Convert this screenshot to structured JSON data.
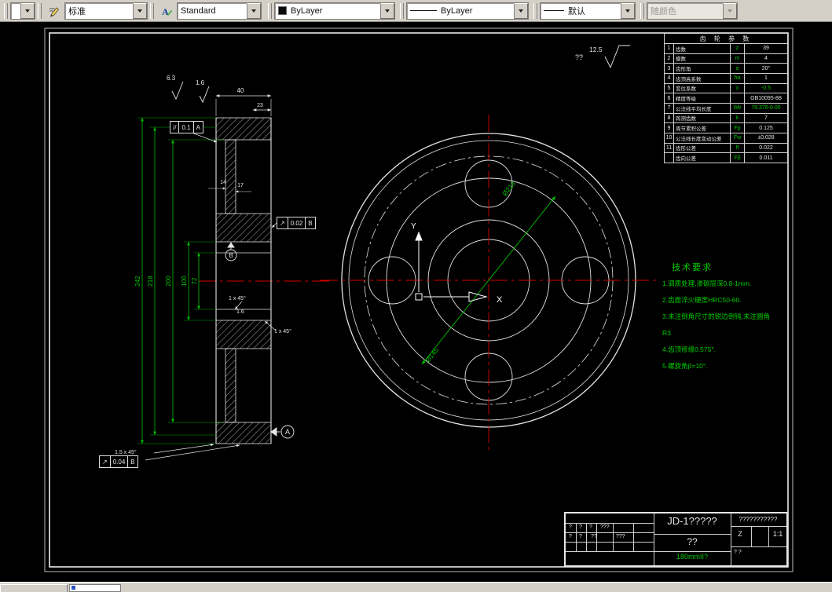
{
  "toolbar": {
    "combo_empty": "",
    "style": "标准",
    "text_style": "Standard",
    "color": "ByLayer",
    "linetype": "ByLayer",
    "lineweight": "默认",
    "plot_style": "随颜色"
  },
  "drawing": {
    "roughness_note": {
      "prefix": "??",
      "value": "12.5"
    },
    "section": {
      "finish_a": "6.3",
      "finish_b": "1.6",
      "dim_242": "242",
      "dim_218": "218",
      "dim_200": "200",
      "dim_100": "100",
      "dim_72": "72",
      "dim_40": "40",
      "dim_23": "23",
      "dim_14": "14",
      "dim_17": "17",
      "chamfer_bore_top": "1 x 45°",
      "chamfer_r": "1.6",
      "chamfer_bore_bottom": "1 x 45°",
      "chamfer_rim": "1.5 x 45°",
      "tol_parallel": {
        "sym": "//",
        "val": "0.1",
        "datum": "A"
      },
      "tol_runout_1": {
        "sym": "↗",
        "val": "0.02",
        "datum": "B"
      },
      "tol_runout_2": {
        "sym": "↗",
        "val": "0.04",
        "datum": "B"
      },
      "datum_a": "A",
      "datum_b": "B"
    },
    "front": {
      "dia_outer": "Ø216",
      "dia_inner": "Ø145",
      "ucs_x": "X",
      "ucs_y": "Y"
    }
  },
  "param_table": {
    "title": "齿 轮 参 数",
    "rows": [
      {
        "no": "1",
        "name": "齿数",
        "sym": "z",
        "val": "39"
      },
      {
        "no": "2",
        "name": "模数",
        "sym": "m",
        "val": "4"
      },
      {
        "no": "3",
        "name": "齿形角",
        "sym": "α",
        "val": "20°"
      },
      {
        "no": "4",
        "name": "齿顶高系数",
        "sym": "ha",
        "val": "1"
      },
      {
        "no": "5",
        "name": "变位系数",
        "sym": "x",
        "val": "-0.5"
      },
      {
        "no": "6",
        "name": "精度等级",
        "sym": "",
        "val": "GB10095-88"
      },
      {
        "no": "7",
        "name": "公法线平均长度",
        "sym": "Wk",
        "val": "79.376-0.05"
      },
      {
        "no": "8",
        "name": "跨测齿数",
        "sym": "k",
        "val": "7"
      },
      {
        "no": "9",
        "name": "周节累积公差",
        "sym": "Fp",
        "val": "0.125"
      },
      {
        "no": "10",
        "name": "公法线长度变动公差",
        "sym": "Fw",
        "val": "±0.028"
      },
      {
        "no": "11",
        "name": "齿形公差",
        "sym": "ff",
        "val": "0.022"
      },
      {
        "no": "",
        "name": "齿向公差",
        "sym": "Fβ",
        "val": "0.011"
      }
    ]
  },
  "notes": {
    "title": "技术要求",
    "items": [
      "1.调质处理,渗碳层深0.8-1mm.",
      "2.齿面淬火硬度HRC50-60.",
      "3.未注倒角尺寸的锐边倒钝,未注圆角",
      "R3.",
      "4.齿顶修缘0.575°.",
      "5.螺旋角β=10°."
    ]
  },
  "title_block": {
    "part_no": "JD-1?????",
    "company": "???????????",
    "part_name": "??",
    "material": "180mmII?",
    "scale": "1:1",
    "z_mark": "Z",
    "marks": [
      "?",
      "?",
      "?",
      "???",
      "?",
      "?",
      "??",
      "? ?",
      "???"
    ]
  }
}
